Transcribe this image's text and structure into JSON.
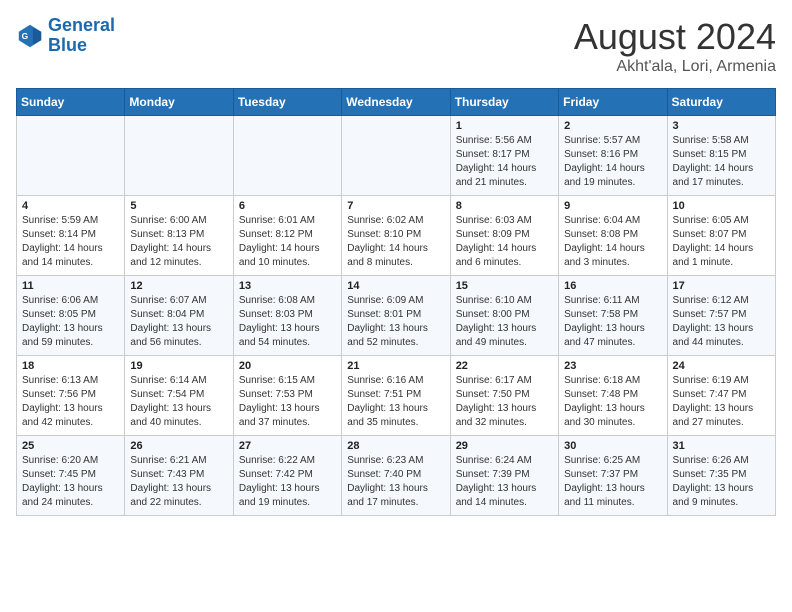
{
  "logo": {
    "line1": "General",
    "line2": "Blue"
  },
  "title": "August 2024",
  "subtitle": "Akht'ala, Lori, Armenia",
  "days_of_week": [
    "Sunday",
    "Monday",
    "Tuesday",
    "Wednesday",
    "Thursday",
    "Friday",
    "Saturday"
  ],
  "weeks": [
    [
      {
        "day": "",
        "info": ""
      },
      {
        "day": "",
        "info": ""
      },
      {
        "day": "",
        "info": ""
      },
      {
        "day": "",
        "info": ""
      },
      {
        "day": "1",
        "info": "Sunrise: 5:56 AM\nSunset: 8:17 PM\nDaylight: 14 hours\nand 21 minutes."
      },
      {
        "day": "2",
        "info": "Sunrise: 5:57 AM\nSunset: 8:16 PM\nDaylight: 14 hours\nand 19 minutes."
      },
      {
        "day": "3",
        "info": "Sunrise: 5:58 AM\nSunset: 8:15 PM\nDaylight: 14 hours\nand 17 minutes."
      }
    ],
    [
      {
        "day": "4",
        "info": "Sunrise: 5:59 AM\nSunset: 8:14 PM\nDaylight: 14 hours\nand 14 minutes."
      },
      {
        "day": "5",
        "info": "Sunrise: 6:00 AM\nSunset: 8:13 PM\nDaylight: 14 hours\nand 12 minutes."
      },
      {
        "day": "6",
        "info": "Sunrise: 6:01 AM\nSunset: 8:12 PM\nDaylight: 14 hours\nand 10 minutes."
      },
      {
        "day": "7",
        "info": "Sunrise: 6:02 AM\nSunset: 8:10 PM\nDaylight: 14 hours\nand 8 minutes."
      },
      {
        "day": "8",
        "info": "Sunrise: 6:03 AM\nSunset: 8:09 PM\nDaylight: 14 hours\nand 6 minutes."
      },
      {
        "day": "9",
        "info": "Sunrise: 6:04 AM\nSunset: 8:08 PM\nDaylight: 14 hours\nand 3 minutes."
      },
      {
        "day": "10",
        "info": "Sunrise: 6:05 AM\nSunset: 8:07 PM\nDaylight: 14 hours\nand 1 minute."
      }
    ],
    [
      {
        "day": "11",
        "info": "Sunrise: 6:06 AM\nSunset: 8:05 PM\nDaylight: 13 hours\nand 59 minutes."
      },
      {
        "day": "12",
        "info": "Sunrise: 6:07 AM\nSunset: 8:04 PM\nDaylight: 13 hours\nand 56 minutes."
      },
      {
        "day": "13",
        "info": "Sunrise: 6:08 AM\nSunset: 8:03 PM\nDaylight: 13 hours\nand 54 minutes."
      },
      {
        "day": "14",
        "info": "Sunrise: 6:09 AM\nSunset: 8:01 PM\nDaylight: 13 hours\nand 52 minutes."
      },
      {
        "day": "15",
        "info": "Sunrise: 6:10 AM\nSunset: 8:00 PM\nDaylight: 13 hours\nand 49 minutes."
      },
      {
        "day": "16",
        "info": "Sunrise: 6:11 AM\nSunset: 7:58 PM\nDaylight: 13 hours\nand 47 minutes."
      },
      {
        "day": "17",
        "info": "Sunrise: 6:12 AM\nSunset: 7:57 PM\nDaylight: 13 hours\nand 44 minutes."
      }
    ],
    [
      {
        "day": "18",
        "info": "Sunrise: 6:13 AM\nSunset: 7:56 PM\nDaylight: 13 hours\nand 42 minutes."
      },
      {
        "day": "19",
        "info": "Sunrise: 6:14 AM\nSunset: 7:54 PM\nDaylight: 13 hours\nand 40 minutes."
      },
      {
        "day": "20",
        "info": "Sunrise: 6:15 AM\nSunset: 7:53 PM\nDaylight: 13 hours\nand 37 minutes."
      },
      {
        "day": "21",
        "info": "Sunrise: 6:16 AM\nSunset: 7:51 PM\nDaylight: 13 hours\nand 35 minutes."
      },
      {
        "day": "22",
        "info": "Sunrise: 6:17 AM\nSunset: 7:50 PM\nDaylight: 13 hours\nand 32 minutes."
      },
      {
        "day": "23",
        "info": "Sunrise: 6:18 AM\nSunset: 7:48 PM\nDaylight: 13 hours\nand 30 minutes."
      },
      {
        "day": "24",
        "info": "Sunrise: 6:19 AM\nSunset: 7:47 PM\nDaylight: 13 hours\nand 27 minutes."
      }
    ],
    [
      {
        "day": "25",
        "info": "Sunrise: 6:20 AM\nSunset: 7:45 PM\nDaylight: 13 hours\nand 24 minutes."
      },
      {
        "day": "26",
        "info": "Sunrise: 6:21 AM\nSunset: 7:43 PM\nDaylight: 13 hours\nand 22 minutes."
      },
      {
        "day": "27",
        "info": "Sunrise: 6:22 AM\nSunset: 7:42 PM\nDaylight: 13 hours\nand 19 minutes."
      },
      {
        "day": "28",
        "info": "Sunrise: 6:23 AM\nSunset: 7:40 PM\nDaylight: 13 hours\nand 17 minutes."
      },
      {
        "day": "29",
        "info": "Sunrise: 6:24 AM\nSunset: 7:39 PM\nDaylight: 13 hours\nand 14 minutes."
      },
      {
        "day": "30",
        "info": "Sunrise: 6:25 AM\nSunset: 7:37 PM\nDaylight: 13 hours\nand 11 minutes."
      },
      {
        "day": "31",
        "info": "Sunrise: 6:26 AM\nSunset: 7:35 PM\nDaylight: 13 hours\nand 9 minutes."
      }
    ]
  ]
}
